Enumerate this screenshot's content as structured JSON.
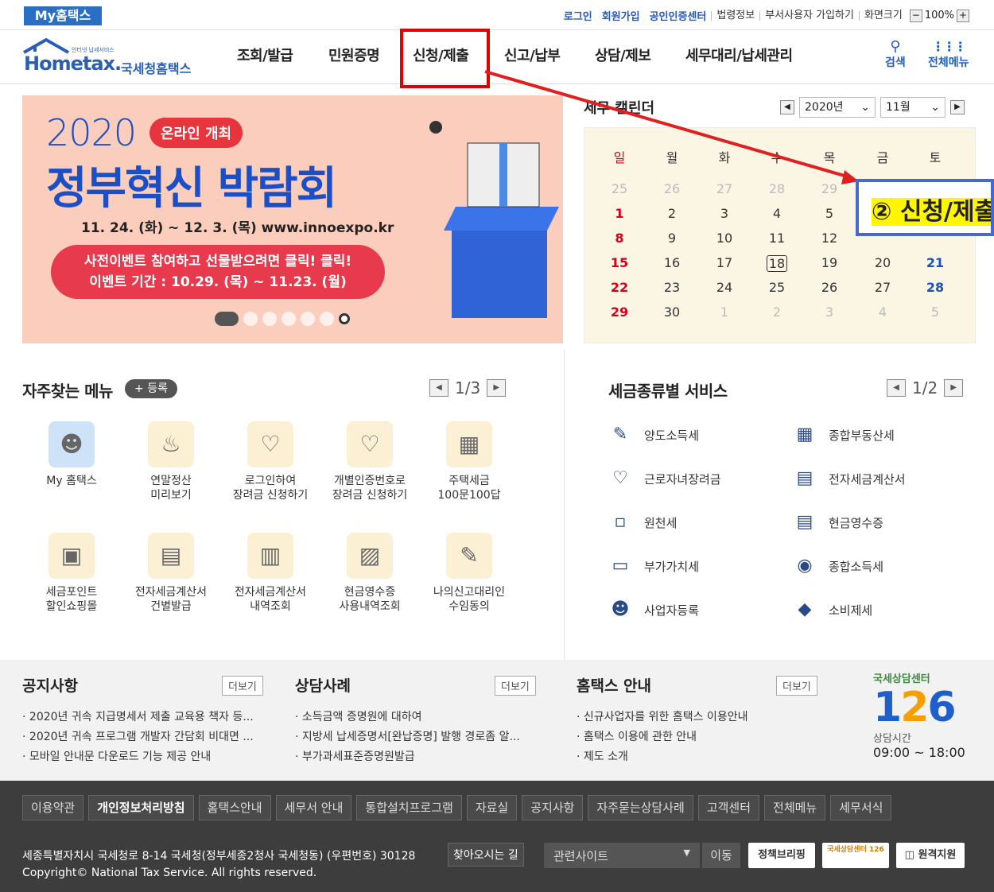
{
  "util": {
    "my": "My홈택스",
    "login": "로그인",
    "join": "회원가입",
    "cert": "공인인증센터",
    "law": "법령정보",
    "dept": "부서사용자 가입하기",
    "screen": "화면크기",
    "zoom": "100%",
    "minus": "−",
    "plus": "+"
  },
  "logo": {
    "small": "인터넷 납세서비스",
    "brand": "Hometax.",
    "kr": "국세청홈택스"
  },
  "nav": [
    "조회/발급",
    "민원증명",
    "신청/제출",
    "신고/납부",
    "상담/제보",
    "세무대리/납세관리"
  ],
  "search": {
    "label": "검색",
    "all": "전체메뉴"
  },
  "banner": {
    "year": "2020",
    "pill": "온라인 개최",
    "title": "정부혁신 박람회",
    "date": "11. 24. (화) ~ 12. 3. (목)   www.innoexpo.kr",
    "ev1": "사전이벤트 참여하고 선물받으려면 클릭! 클릭!",
    "ev2": "이벤트 기간 : 10.29. (목) ~ 11.23. (월)"
  },
  "calendar": {
    "title": "세무 캘린더",
    "year": "2020년",
    "month": "11월",
    "days": [
      "일",
      "월",
      "화",
      "수",
      "목",
      "금",
      "토"
    ],
    "weeks": [
      [
        "25",
        "26",
        "27",
        "28",
        "29",
        "",
        ""
      ],
      [
        "1",
        "2",
        "3",
        "4",
        "5",
        "",
        ""
      ],
      [
        "8",
        "9",
        "10",
        "11",
        "12",
        "",
        ""
      ],
      [
        "15",
        "16",
        "17",
        "18",
        "19",
        "20",
        "21"
      ],
      [
        "22",
        "23",
        "24",
        "25",
        "26",
        "27",
        "28"
      ],
      [
        "29",
        "30",
        "1",
        "2",
        "3",
        "4",
        "5"
      ]
    ],
    "callout": "② 신청/제출"
  },
  "fav": {
    "title": "자주찾는 메뉴",
    "reg": "+ 등록",
    "page": "1/3",
    "items": [
      {
        "l1": "My 홈택스",
        "l2": "",
        "icon": "person-icon"
      },
      {
        "l1": "연말정산",
        "l2": "미리보기",
        "icon": "money-bag-icon"
      },
      {
        "l1": "로그인하여",
        "l2": "장려금 신청하기",
        "icon": "heart-hand-icon"
      },
      {
        "l1": "개별인증번호로",
        "l2": "장려금 신청하기",
        "icon": "heart-key-icon"
      },
      {
        "l1": "주택세금",
        "l2": "100문100답",
        "icon": "building-icon"
      },
      {
        "l1": "세금포인트",
        "l2": "할인쇼핑몰",
        "icon": "tax-bag-icon"
      },
      {
        "l1": "전자세금계산서",
        "l2": "건별발급",
        "icon": "calculator-icon"
      },
      {
        "l1": "전자세금계산서",
        "l2": "내역조회",
        "icon": "doc-search-icon"
      },
      {
        "l1": "현금영수증",
        "l2": "사용내역조회",
        "icon": "bill-search-icon"
      },
      {
        "l1": "나의신고대리인",
        "l2": "수임동의",
        "icon": "doc-sign-icon"
      }
    ]
  },
  "svc": {
    "title": "세금종류별 서비스",
    "page": "1/2",
    "items": [
      "양도소득세",
      "종합부동산세",
      "근로자녀장려금",
      "전자세금계산서",
      "원천세",
      "현금영수증",
      "부가가치세",
      "종합소득세",
      "사업자등록",
      "소비제세"
    ]
  },
  "notice": {
    "t1": "공지사항",
    "t2": "상담사례",
    "t3": "홈택스 안내",
    "more": "더보기",
    "n1": [
      "2020년 귀속 지급명세서 제출 교육용 책자 등...",
      "2020년 귀속 프로그램 개발자 간담회 비대면 ...",
      "모바일 안내문 다운로드 기능 제공 안내"
    ],
    "n2": [
      "소득금액 증명원에 대하여",
      "지방세 납세증명서[완납증명] 발행 경로좀 알...",
      "부가과세표준증명원발급"
    ],
    "n3": [
      "신규사업자를 위한 홈택스 이용안내",
      "홈택스 이용에 관한 안내",
      "제도 소개"
    ],
    "c126": "국세상담센터",
    "hours_label": "상담시간",
    "hours": "09:00 ~ 18:00"
  },
  "footer": {
    "links": [
      "이용약관",
      "개인정보처리방침",
      "홈택스안내",
      "세무서 안내",
      "통합설치프로그램",
      "자료실",
      "공지사항",
      "자주묻는상담사례",
      "고객센터",
      "전체메뉴",
      "세무서식"
    ],
    "addr": "세종특별자치시 국세청로 8-14 국세청(정부세종2청사 국세청동) (우편번호) 30128",
    "find": "찾아오시는 길",
    "copy": "Copyright© National Tax Service. All rights reserved.",
    "related": "관련사이트",
    "go": "이동",
    "b1": "정책브리핑",
    "b2": "국세상담센터 126",
    "b3": "원격지원"
  }
}
